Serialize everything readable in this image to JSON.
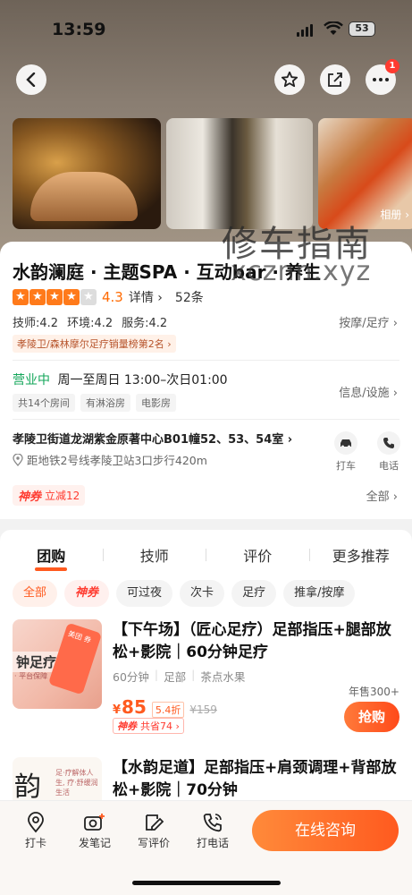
{
  "status_bar": {
    "time": "13:59",
    "battery": "53"
  },
  "nav": {
    "notification_count": "1"
  },
  "gallery": {
    "album_label": "相册 ›"
  },
  "watermark": {
    "line1": "修车指南",
    "line2": "xcznn.xyz"
  },
  "shop": {
    "title": "水韵澜庭 · 主题SPA · 互动bar · 养生",
    "rating": "4.3",
    "stars_filled": 4,
    "stars_total": 5,
    "detail_label": "详情 ›",
    "review_count": "52条",
    "scores": [
      "技师:4.2",
      "环境:4.2",
      "服务:4.2"
    ],
    "category_link": "按摩/足疗 ›",
    "rank_badge": "孝陵卫/森林摩尔足疗销量榜第2名 ›",
    "open_status": "营业中",
    "hours": "周一至周日 13:00–次日01:00",
    "facility_tags": [
      "共14个房间",
      "有淋浴房",
      "电影房"
    ],
    "info_link": "信息/设施 ›",
    "address": "孝陵卫街道龙湖紫金原著中心B01幢52、53、54室 ›",
    "metro": "距地铁2号线孝陵卫站3口步行420m",
    "actions": {
      "taxi": "打车",
      "call": "电话"
    },
    "promo": {
      "brand": "神券",
      "text": "立减12"
    },
    "all_link": "全部 ›"
  },
  "deals_section": {
    "tabs": [
      "团购",
      "技师",
      "评价",
      "更多推荐"
    ],
    "active_tab": 0,
    "chips": [
      "全部",
      "神券",
      "可过夜",
      "次卡",
      "足疗",
      "推拿/按摩"
    ],
    "items": [
      {
        "title": "【下午场】（匠心足疗）足部指压+腿部放松+影院｜60分钟足疗",
        "thumb_label": "钟足疗",
        "thumb_sub": "· 平台保障",
        "thumb_phone": "美团 券",
        "meta": [
          "60分钟",
          "足部",
          "茶点水果"
        ],
        "yen": "¥",
        "price": "85",
        "discount": "5.4折",
        "original_price": "¥159",
        "saving_brand": "神券",
        "saving_text": "共省74 ›",
        "sold": "年售300+",
        "buy_label": "抢购"
      },
      {
        "title": "【水韵足道】足部指压+肩颈调理+背部放松+影院｜70分钟",
        "thumb_big": "韵",
        "thumb_small": "足·疗解体人生, 疗·舒缓润生活"
      }
    ]
  },
  "bottom_bar": {
    "items": [
      "打卡",
      "发笔记",
      "写评价",
      "打电话"
    ],
    "consult_label": "在线咨询"
  },
  "colors": {
    "accent": "#ff5a1f",
    "open_green": "#13a65a",
    "promo_red": "#ff3b30"
  }
}
